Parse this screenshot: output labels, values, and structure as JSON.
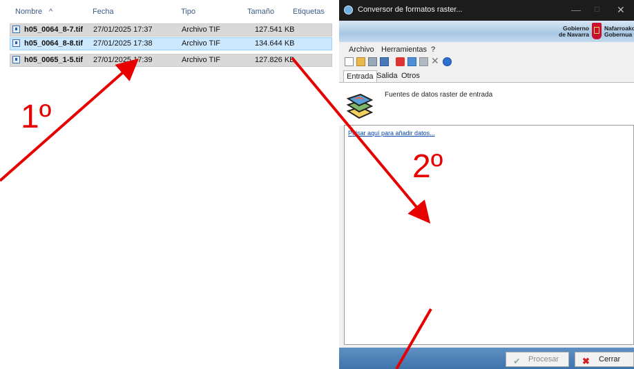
{
  "explorer": {
    "columns": {
      "name": "Nombre",
      "date": "Fecha",
      "type": "Tipo",
      "size": "Tamaño",
      "tags": "Etiquetas"
    },
    "sort_arrow": "^",
    "files": [
      {
        "name": "h05_0064_8-7.tif",
        "date": "27/01/2025 17:37",
        "type": "Archivo TIF",
        "size": "127.541 KB"
      },
      {
        "name": "h05_0064_8-8.tif",
        "date": "27/01/2025 17:38",
        "type": "Archivo TIF",
        "size": "134.644 KB"
      },
      {
        "name": "h05_0065_1-5.tif",
        "date": "27/01/2025 17:39",
        "type": "Archivo TIF",
        "size": "127.826 KB"
      }
    ]
  },
  "window": {
    "title": "Conversor de formatos raster...",
    "controls": {
      "minimize": "—",
      "maximize": "□",
      "close": "✕"
    },
    "banner": {
      "gob_line1": "Gobierno",
      "gob_line2": "de Navarra",
      "naf_line1": "Nafarroako",
      "naf_line2": "Gobernua"
    },
    "menu": [
      "Archivo",
      "Herramientas",
      "?"
    ],
    "toolbar_icons": [
      "new-icon",
      "open-icon",
      "save-icon",
      "save-as-icon",
      "add-layer-icon",
      "copy-icon",
      "paste-icon",
      "delete-icon",
      "help-icon"
    ],
    "tabs": [
      "Entrada",
      "Salida",
      "Otros"
    ],
    "active_tab": "Entrada",
    "panel_title": "Fuentes de datos raster de entrada",
    "add_data_link": "Pulsar aquí para añadir datos...",
    "buttons": {
      "process": "Procesar",
      "close": "Cerrar"
    }
  },
  "annotations": {
    "step1": "1º",
    "step2": "2º",
    "color": "#e60000"
  },
  "colors": {
    "accent": "#3e73ac",
    "selection": "#cce8ff",
    "link": "#0645ad"
  }
}
